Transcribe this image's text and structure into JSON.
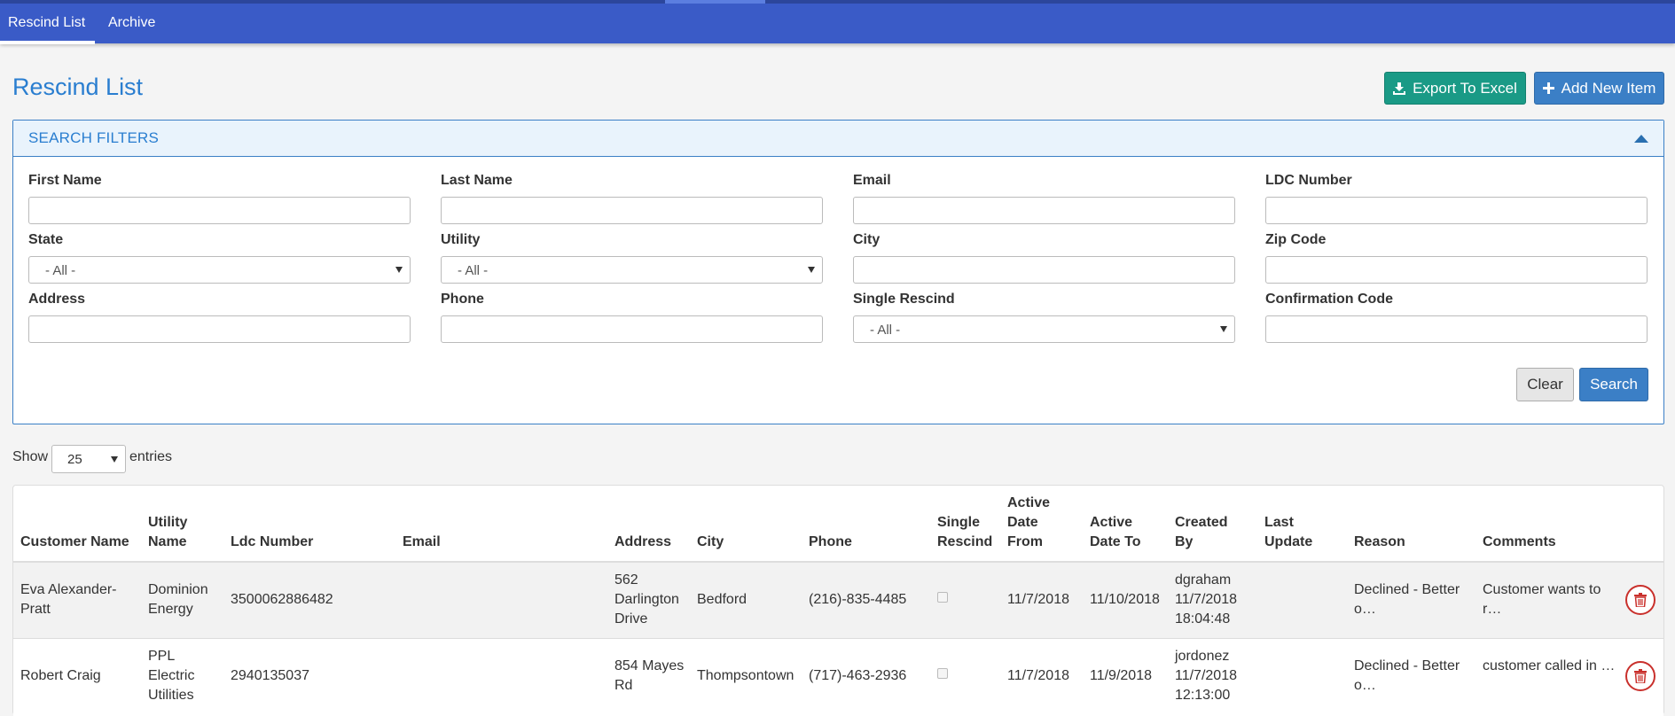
{
  "nav": {
    "tabs": [
      {
        "label": "Rescind List",
        "active": true
      },
      {
        "label": "Archive",
        "active": false
      }
    ]
  },
  "page": {
    "title": "Rescind List",
    "export_label": "Export To Excel",
    "add_label": "Add New Item"
  },
  "filters": {
    "title": "SEARCH FILTERS",
    "first_name": "First Name",
    "last_name": "Last Name",
    "email": "Email",
    "ldc_number": "LDC Number",
    "state": "State",
    "state_value": "- All -",
    "utility": "Utility",
    "utility_value": "- All -",
    "city": "City",
    "zip_code": "Zip Code",
    "address": "Address",
    "phone": "Phone",
    "single_rescind": "Single Rescind",
    "single_rescind_value": "- All -",
    "confirmation_code": "Confirmation Code",
    "clear_label": "Clear",
    "search_label": "Search"
  },
  "entries": {
    "show_label": "Show",
    "value": "25",
    "entries_label": "entries"
  },
  "table": {
    "headers": {
      "customer_name": "Customer Name",
      "utility_name": "Utility Name",
      "ldc_number": "Ldc Number",
      "email": "Email",
      "address": "Address",
      "city": "City",
      "phone": "Phone",
      "single_rescind": "Single Rescind",
      "active_date_from": "Active Date From",
      "active_date_to": "Active Date To",
      "created_by": "Created By",
      "last_update": "Last Update",
      "reason": "Reason",
      "comments": "Comments"
    },
    "rows": [
      {
        "customer_name": "Eva Alexander-Pratt",
        "utility_name": "Dominion Energy",
        "ldc_number": "3500062886482",
        "email": "",
        "address": "562 Darlington Drive",
        "city": "Bedford",
        "phone": "(216)-835-4485",
        "single_rescind": false,
        "active_date_from": "11/7/2018",
        "active_date_to": "11/10/2018",
        "created_by_user": "dgraham",
        "created_by_date": "11/7/2018",
        "created_by_time": "18:04:48",
        "last_update": "",
        "reason": "Declined - Better o…",
        "comments": "Customer wants to r…"
      },
      {
        "customer_name": "Robert Craig",
        "utility_name": "PPL Electric Utilities",
        "ldc_number": "2940135037",
        "email": "",
        "address": "854 Mayes Rd",
        "city": "Thompsontown",
        "phone": "(717)-463-2936",
        "single_rescind": false,
        "active_date_from": "11/7/2018",
        "active_date_to": "11/9/2018",
        "created_by_user": "jordonez",
        "created_by_date": "11/7/2018",
        "created_by_time": "12:13:00",
        "last_update": "",
        "reason": "Declined - Better o…",
        "comments": "customer called in …"
      }
    ]
  },
  "colors": {
    "nav_bg": "#3a5bc7",
    "primary": "#3b7fc6",
    "export": "#1a9a86",
    "danger": "#c9302c"
  },
  "icons": {
    "export": "download-icon",
    "add": "plus-icon",
    "collapse": "caret-up-icon",
    "delete": "trash-icon"
  }
}
